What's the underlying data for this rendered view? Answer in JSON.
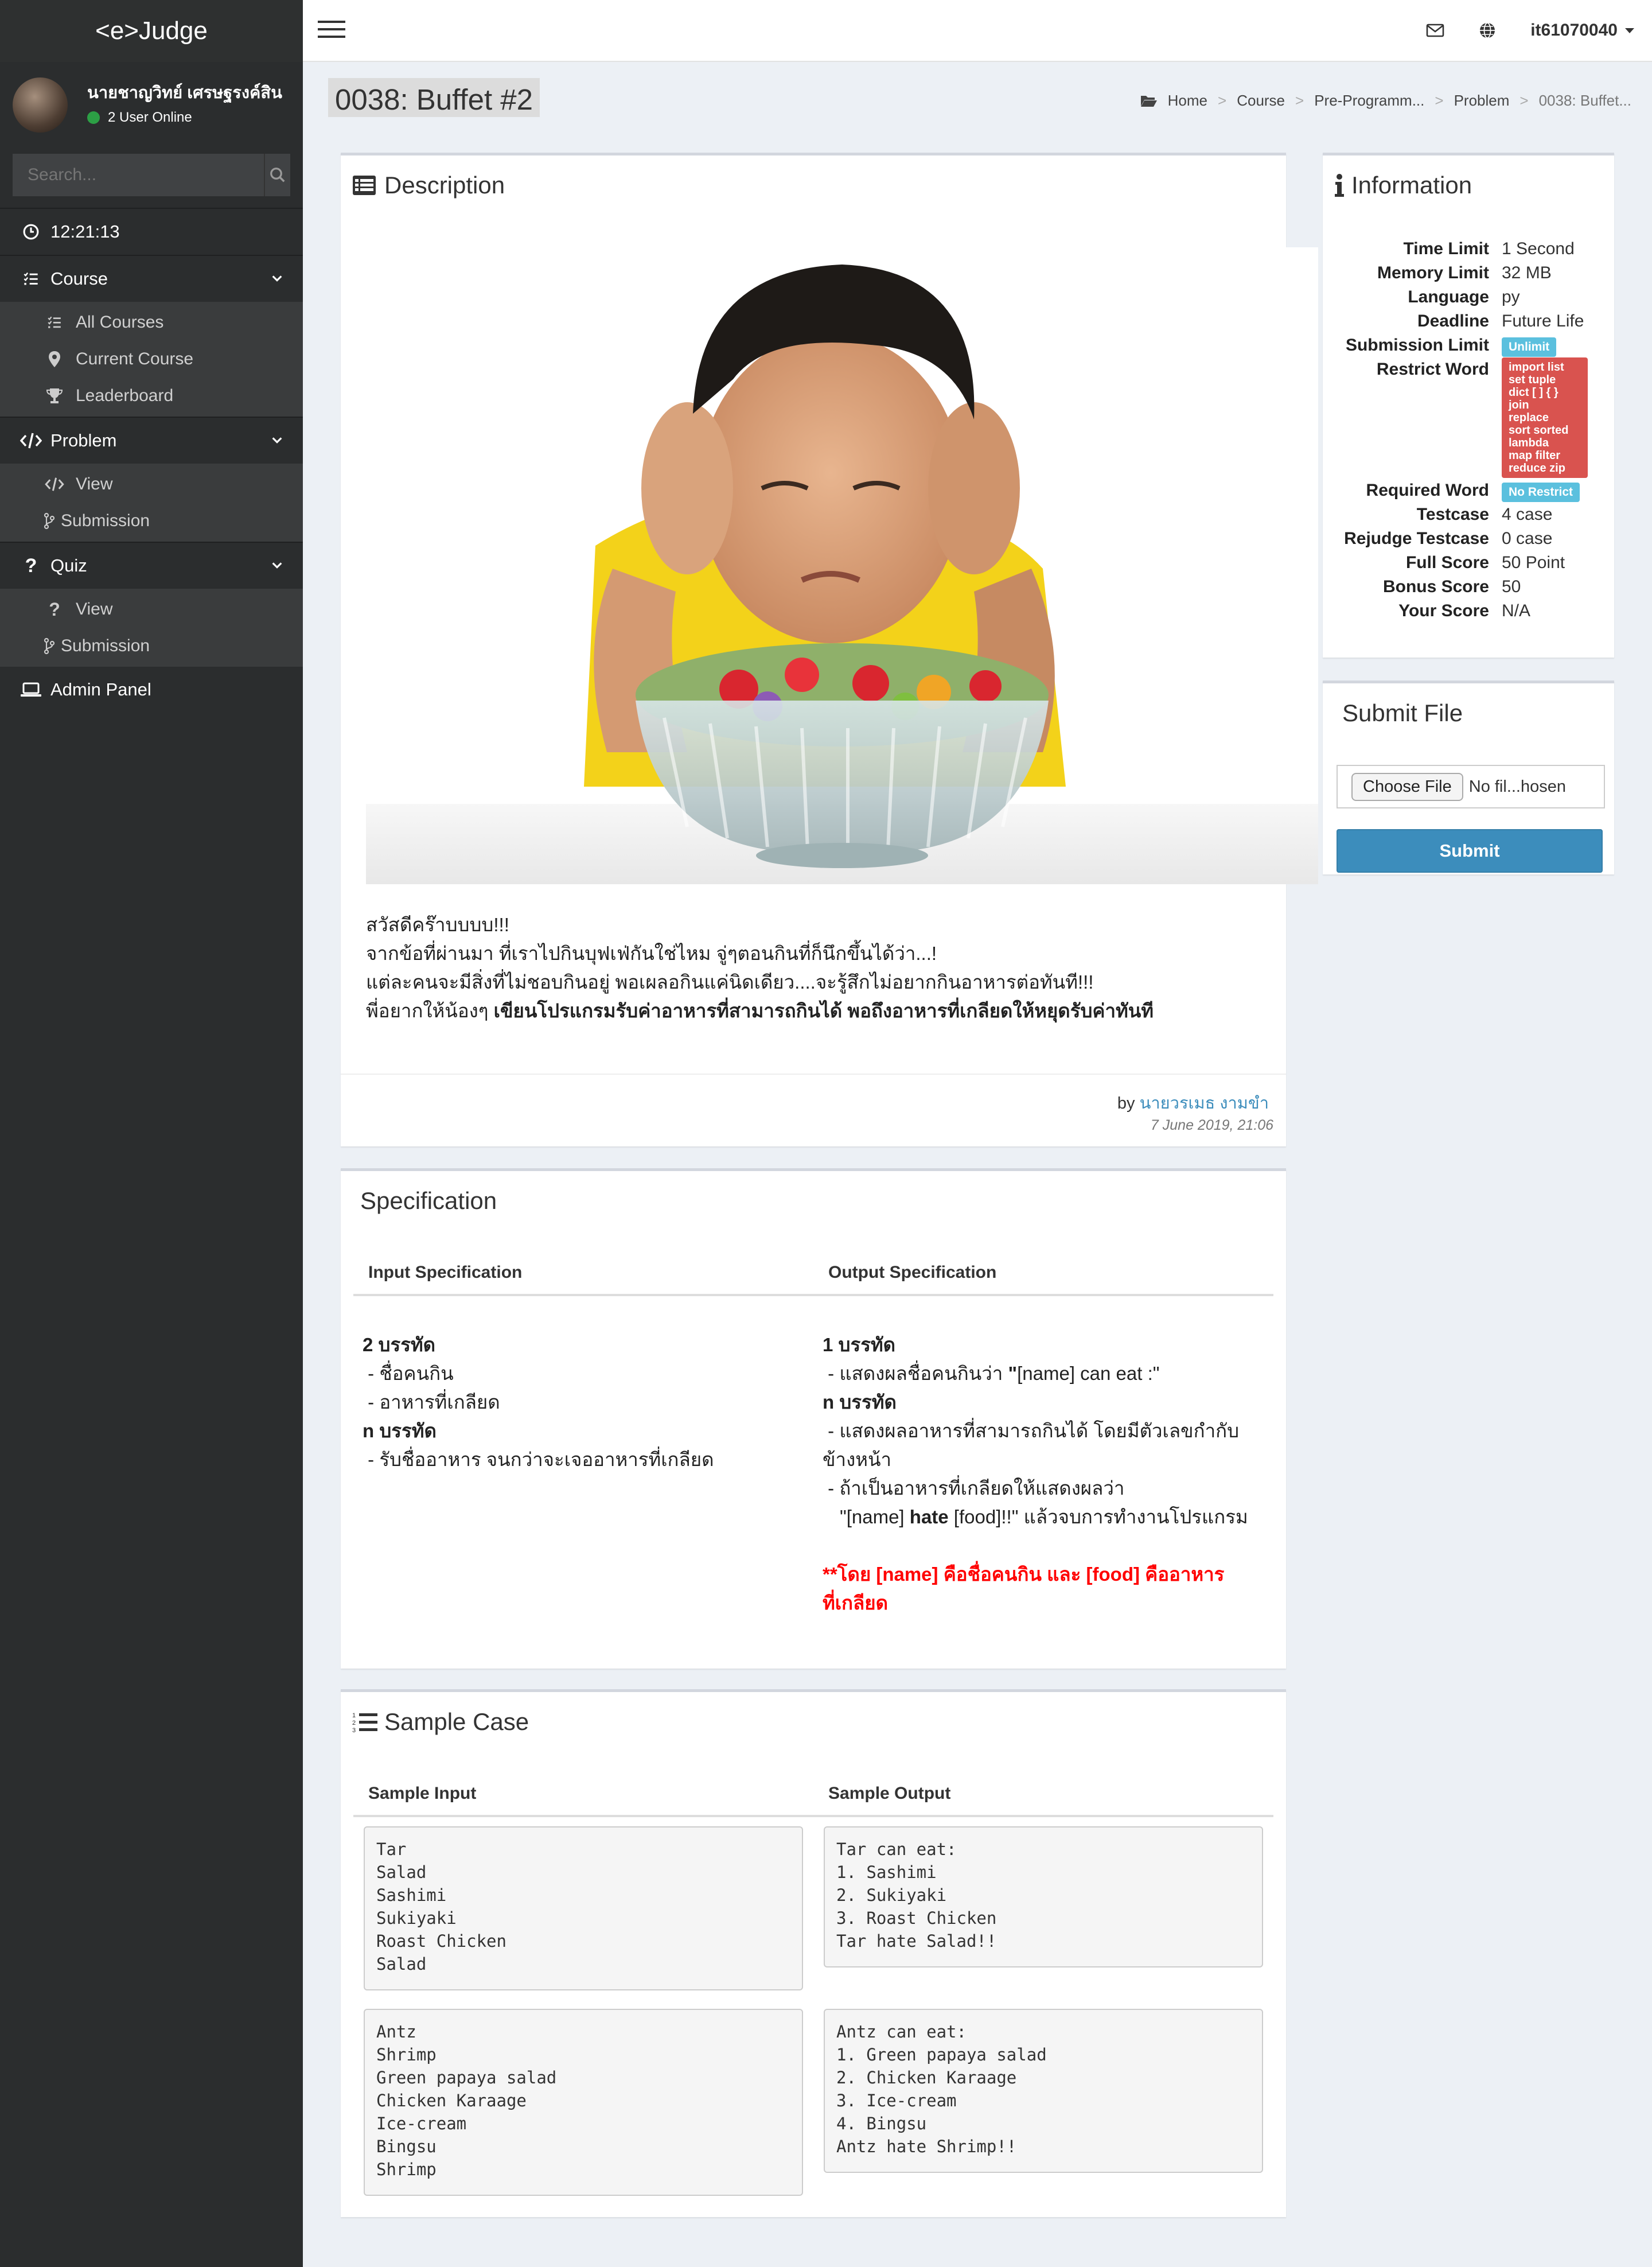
{
  "app": {
    "logo": "<e>Judge"
  },
  "user": {
    "name": "นายชาญวิทย์ เศรษฐรงค์สิน",
    "online": "2 User Online",
    "account": "it61070040"
  },
  "search": {
    "placeholder": "Search..."
  },
  "clock": "12:21:13",
  "sidebar": {
    "course": {
      "label": "Course",
      "items": [
        "All Courses",
        "Current Course",
        "Leaderboard"
      ]
    },
    "problem": {
      "label": "Problem",
      "items": [
        "View",
        "Submission"
      ]
    },
    "quiz": {
      "label": "Quiz",
      "items": [
        "View",
        "Submission"
      ]
    },
    "admin": "Admin Panel"
  },
  "page": {
    "title": "0038: Buffet #2"
  },
  "breadcrumb": [
    "Home",
    "Course",
    "Pre-Programm...",
    "Problem",
    "0038: Buffet..."
  ],
  "description": {
    "title": "Description",
    "lines": [
      "สวัสดีคร๊าบบบบ!!!",
      "จากข้อที่ผ่านมา ที่เราไปกินบุฟเฟ่กันใช่ไหม จู่ๆตอนกินที่ก็นึกขึ้นได้ว่า...!",
      "แต่ละคนจะมีสิ่งที่ไม่ชอบกินอยู่ พอเผลอกินแค่นิดเดียว....จะรู้สึกไม่อยากกินอาหารต่อทันที!!!"
    ],
    "last_prefix": "พี่อยากให้น้องๆ ",
    "last_bold": "เขียนโปรแกรมรับค่าอาหารที่สามารถกินได้ พอถึงอาหารที่เกลียดให้หยุดรับค่าทันที",
    "by": "by",
    "author": "นายวรเมธ งามขำ",
    "date": "7 June 2019, 21:06"
  },
  "information": {
    "title": "Information",
    "rows": {
      "time_limit": {
        "k": "Time Limit",
        "v": "1 Second"
      },
      "memory_limit": {
        "k": "Memory Limit",
        "v": "32 MB"
      },
      "language": {
        "k": "Language",
        "v": "py"
      },
      "deadline": {
        "k": "Deadline",
        "v": "Future Life"
      },
      "submission_limit": {
        "k": "Submission Limit",
        "v": "Unlimit"
      },
      "restrict_word": {
        "k": "Restrict Word",
        "v": [
          "import list",
          "set tuple",
          "dict [ ] { }",
          "join",
          "replace",
          "sort sorted",
          "lambda",
          "map filter",
          "reduce zip"
        ]
      },
      "required_word": {
        "k": "Required Word",
        "v": "No Restrict"
      },
      "testcase": {
        "k": "Testcase",
        "v": "4 case"
      },
      "rejudge": {
        "k": "Rejudge Testcase",
        "v": "0 case"
      },
      "full_score": {
        "k": "Full Score",
        "v": "50 Point"
      },
      "bonus_score": {
        "k": "Bonus Score",
        "v": "50"
      },
      "your_score": {
        "k": "Your Score",
        "v": "N/A"
      }
    }
  },
  "submit": {
    "title": "Submit File",
    "choose": "Choose File",
    "no_file": "No fil...hosen",
    "button": "Submit"
  },
  "specification": {
    "title": "Specification",
    "input_head": "Input Specification",
    "output_head": "Output Specification",
    "input_lines": [
      {
        "t": "2 บรรทัด",
        "b": true
      },
      {
        "t": " - ชื่อคนกิน",
        "b": false
      },
      {
        "t": " - อาหารที่เกลียด",
        "b": false
      },
      {
        "t": "n บรรทัด",
        "b": true
      },
      {
        "t": " - รับชื่ออาหาร จนกว่าจะเจออาหารที่เกลียด",
        "b": false
      }
    ],
    "output": {
      "l1": "1 บรรทัด",
      "l2_pre": " - แสดงผลชื่อคนกินว่า ",
      "l2_q": "\"",
      "l2_text": "[name] can eat :\"",
      "l3": "n บรรทัด",
      "l4": " - แสดงผลอาหารที่สามารถกินได้ โดยมีตัวเลขกำกับ",
      "l5": "ข้างหน้า",
      "l6": " - ถ้าเป็นอาหารที่เกลียดให้แสดงผลว่า",
      "l7_a": "\"[name] ",
      "l7_b": "hate",
      "l7_c": " [food]!!\" แล้วจบการทำงานโปรแกรม",
      "note1": "**โดย [name] คือชื่อคนกิน และ [food] คืออาหาร",
      "note2": "ที่เกลียด"
    }
  },
  "sample": {
    "title": "Sample Case",
    "input_head": "Sample Input",
    "output_head": "Sample Output",
    "in1": "Tar\nSalad\nSashimi\nSukiyaki\nRoast Chicken\nSalad",
    "out1": "Tar can eat:\n1. Sashimi\n2. Sukiyaki\n3. Roast Chicken\nTar hate Salad!!",
    "in2": "Antz\nShrimp\nGreen papaya salad\nChicken Karaage\nIce-cream\nBingsu\nShrimp",
    "out2": "Antz can eat:\n1. Green papaya salad\n2. Chicken Karaage\n3. Ice-cream\n4. Bingsu\nAntz hate Shrimp!!"
  }
}
